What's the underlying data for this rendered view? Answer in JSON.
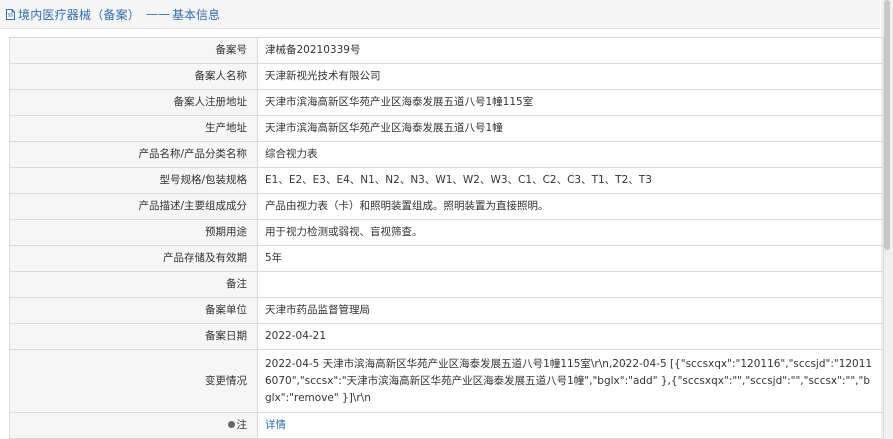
{
  "header": {
    "title": "境内医疗器械（备案）",
    "separator": "——",
    "subtitle": "基本信息",
    "icon": "document-icon",
    "accent_color": "#2d6fb5"
  },
  "rows": [
    {
      "label": "备案号",
      "value": "津械备20210339号"
    },
    {
      "label": "备案人名称",
      "value": "天津新视光技术有限公司"
    },
    {
      "label": "备案人注册地址",
      "value": "天津市滨海高新区华苑产业区海泰发展五道八号1幢115室"
    },
    {
      "label": "生产地址",
      "value": "天津市滨海高新区华苑产业区海泰发展五道八号1幢"
    },
    {
      "label": "产品名称/产品分类名称",
      "value": "综合视力表"
    },
    {
      "label": "型号规格/包装规格",
      "value": "E1、E2、E3、E4、N1、N2、N3、W1、W2、W3、C1、C2、C3、T1、T2、T3"
    },
    {
      "label": "产品描述/主要组成成分",
      "value": "产品由视力表（卡）和照明装置组成。照明装置为直接照明。"
    },
    {
      "label": "预期用途",
      "value": "用于视力检测或弱视、盲视筛查。"
    },
    {
      "label": "产品存储及有效期",
      "value": "5年"
    },
    {
      "label": "备注",
      "value": ""
    },
    {
      "label": "备案单位",
      "value": "天津市药品监督管理局"
    },
    {
      "label": "备案日期",
      "value": "2022-04-21"
    },
    {
      "label": "变更情况",
      "value": "2022-04-5 天津市滨海高新区华苑产业区海泰发展五道八号1幢115室\\r\\n,2022-04-5 [{\"sccsxqx\":\"120116\",\"sccsjd\":\"120116070\",\"sccsx\":\"天津市滨海高新区华苑产业区海泰发展五道八号1幢\",\"bglx\":\"add\" },{\"sccsxqx\":\"\",\"sccsjd\":\"\",\"sccsx\":\"\",\"bglx\":\"remove\" }]\\r\\n"
    }
  ],
  "note": {
    "label": "注",
    "link_text": "详情",
    "icon": "location-pin-icon"
  }
}
